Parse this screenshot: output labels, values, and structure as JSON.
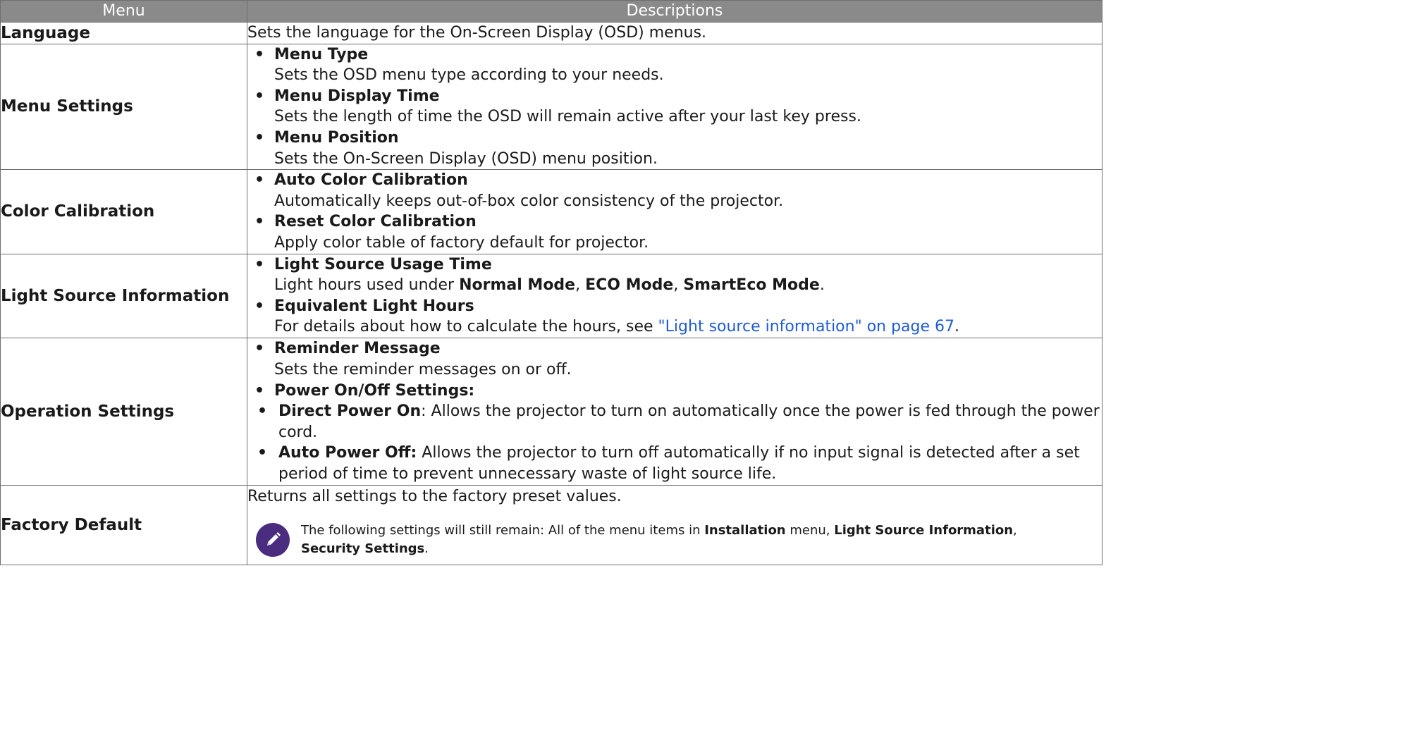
{
  "header": {
    "menu": "Menu",
    "descriptions": "Descriptions"
  },
  "rows": {
    "language": {
      "menu": "Language",
      "desc": "Sets the language for the On-Screen Display (OSD) menus."
    },
    "menu_settings": {
      "menu": "Menu Settings",
      "items": [
        {
          "title": "Menu Type",
          "text": "Sets the OSD menu type according to your needs."
        },
        {
          "title": "Menu Display Time",
          "text": "Sets the length of time the OSD will remain active after your last key press."
        },
        {
          "title": "Menu Position",
          "text": "Sets the On-Screen Display (OSD) menu position."
        }
      ]
    },
    "color_calibration": {
      "menu": "Color Calibration",
      "items": [
        {
          "title": "Auto Color Calibration",
          "text": "Automatically keeps out-of-box color consistency of the projector."
        },
        {
          "title": "Reset Color Calibration",
          "text": "Apply color table of factory default for projector."
        }
      ]
    },
    "light_source": {
      "menu": "Light Source Information",
      "usage_title": "Light Source Usage Time",
      "usage_prefix": "Light hours used under ",
      "mode_normal": "Normal Mode",
      "sep1": ", ",
      "mode_eco": "ECO Mode",
      "sep2": ", ",
      "mode_smarteco": "SmartEco Mode",
      "usage_suffix": ".",
      "equiv_title": "Equivalent Light Hours",
      "equiv_prefix": "For details about how to calculate the hours, see ",
      "equiv_link": "\"Light source information\" on page 67",
      "equiv_suffix": "."
    },
    "operation_settings": {
      "menu": "Operation Settings",
      "reminder_title": "Reminder Message",
      "reminder_text": "Sets the reminder messages on or off.",
      "power_title": "Power On/Off Settings:",
      "direct_title": "Direct Power On",
      "direct_text": ": Allows the projector to turn on automatically once the power is fed through the power cord.",
      "auto_title": "Auto Power Off:",
      "auto_text": " Allows the projector to turn off automatically if no input signal is detected after a set period of time to prevent unnecessary waste of light source life."
    },
    "factory_default": {
      "menu": "Factory Default",
      "desc": "Returns all settings to the factory preset values.",
      "note_prefix": "The following settings will still remain: All of the menu items in ",
      "note_installation": "Installation",
      "note_mid": " menu, ",
      "note_light": "Light Source Information",
      "note_comma": ",",
      "note_security": "Security Settings",
      "note_end": "."
    }
  },
  "bullet": "•",
  "icons": {
    "note": "pencil-icon"
  },
  "colors": {
    "header_bg": "#8a8a8a",
    "link": "#1f5bd6",
    "note_icon_bg": "#4b2d80"
  }
}
